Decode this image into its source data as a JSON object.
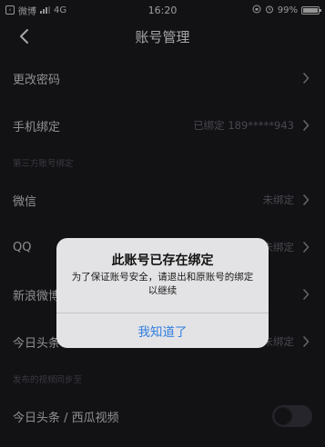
{
  "status_bar": {
    "carrier_app": "微博",
    "network": "4G",
    "time": "16:20",
    "battery": "99%",
    "battery_level": 0.99
  },
  "nav": {
    "title": "账号管理"
  },
  "rows": {
    "change_password": {
      "label": "更改密码"
    },
    "phone_binding": {
      "label": "手机绑定",
      "value": "已绑定 189*****943"
    },
    "third_party_header": "第三方账号绑定",
    "wechat": {
      "label": "微信",
      "value": "未绑定"
    },
    "qq": {
      "label": "QQ",
      "value": "未绑定"
    },
    "weibo": {
      "label": "新浪微博",
      "value": ""
    },
    "toutiao": {
      "label": "今日头条",
      "value": "未绑定"
    },
    "sync_header": "发布的视频同步至",
    "toutiao_xigua": {
      "label": "今日头条 / 西瓜视频",
      "enabled": false
    }
  },
  "alert": {
    "title": "此账号已存在绑定",
    "message": "为了保证账号安全，请退出和原账号的绑定以继续",
    "button": "我知道了"
  },
  "colors": {
    "background": "#1c1c21",
    "alert_button": "#2f7de1"
  }
}
